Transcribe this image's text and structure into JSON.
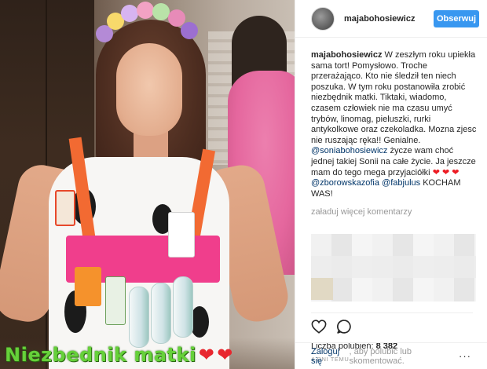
{
  "photo": {
    "caption_text": "Niezbednik matki",
    "caption_hearts": [
      "❤",
      "❤"
    ]
  },
  "header": {
    "username": "majabohosiewicz",
    "follow_label": "Obserwuj"
  },
  "post": {
    "author": "majabohosiewicz",
    "text_part1": "W zeszłym roku upiekła sama tort! Pomysłowo. Troche przerażająco. Kto nie śledził ten niech poszuka. W tym roku postanowiła zrobić niezbędnik matki. Tiktaki, wiadomo, czasem człowiek nie ma czasu umyć trybów, linomag, pieluszki, rurki antykolkowe oraz czekoladka. Mozna zjesc nie ruszając ręka!! Genialne.",
    "mention1": "@soniabohosiewicz",
    "text_part2": "życze wam choć jednej takiej Sonii na całe życie. Ja jeszcze mam do tego mega przyjaciółki",
    "hearts": "❤ ❤ ❤",
    "mention2": "@zborowskazofia",
    "mention3": "@fabjulus",
    "text_part3": "KOCHAM WAS!"
  },
  "load_more": "załaduj więcej komentarzy",
  "likes": {
    "label": "Liczba polubień:",
    "count": "8 382"
  },
  "timestamp": "4 DNI TEMU",
  "login": {
    "link": "Zaloguj się",
    "rest": ", aby polubić lub skomentować."
  },
  "icons": {
    "like": "heart-outline-icon",
    "comment": "comment-bubble-icon",
    "more": "ellipsis-icon"
  },
  "colors": {
    "follow_button": "#3897f0",
    "mention": "#003569",
    "caption_green": "#66d13a",
    "heart_red": "#ed1c24"
  }
}
